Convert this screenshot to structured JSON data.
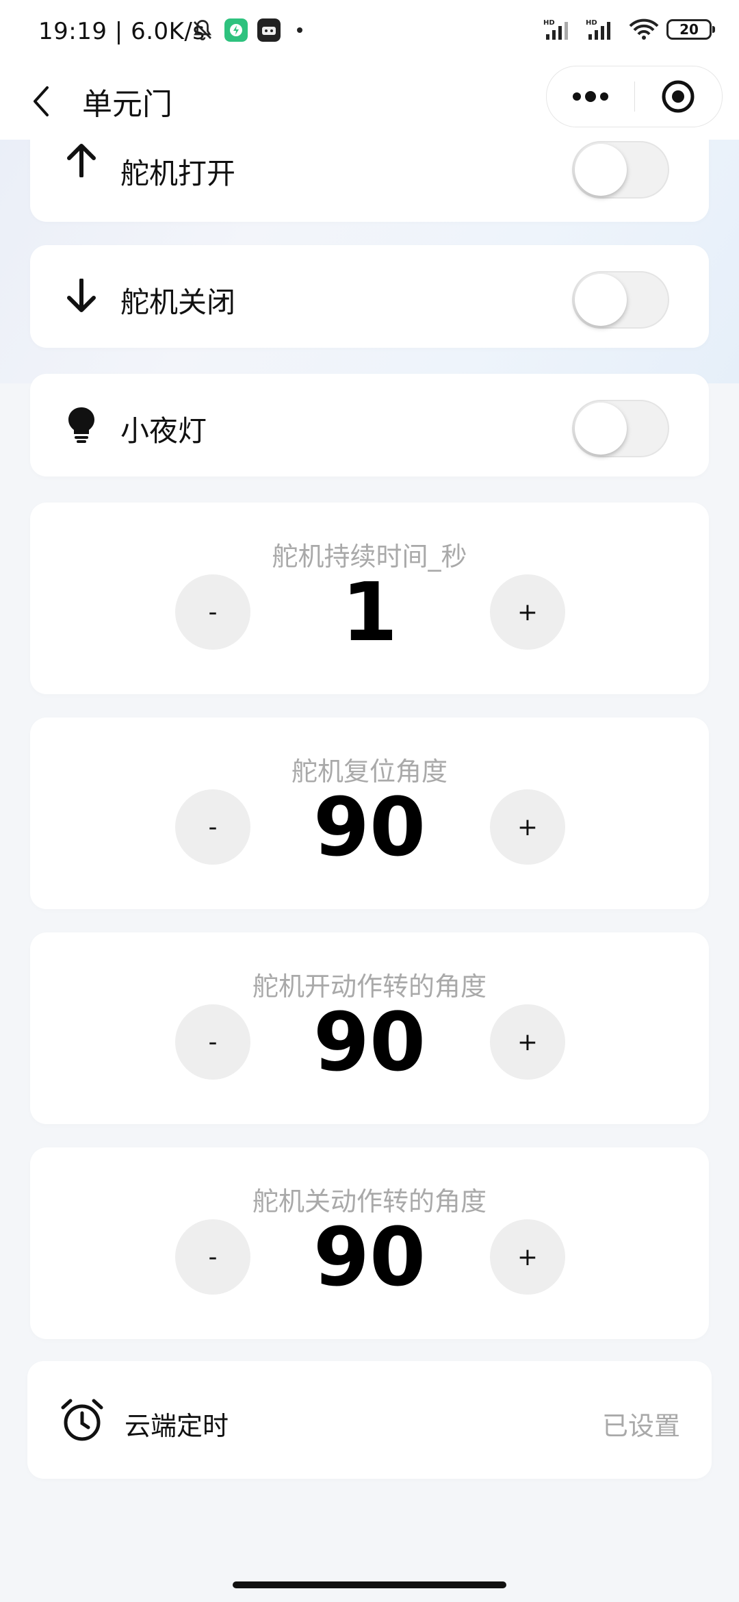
{
  "status_bar": {
    "time": "19:19",
    "network_speed": "6.0K/s",
    "battery": "20",
    "signal_1_label": "HD",
    "signal_2_label": "HD"
  },
  "nav": {
    "title": "单元门"
  },
  "toggles": [
    {
      "label": "舵机打开",
      "icon": "arrow-up-icon",
      "on": false
    },
    {
      "label": "舵机关闭",
      "icon": "arrow-down-icon",
      "on": false
    },
    {
      "label": "小夜灯",
      "icon": "bulb-icon",
      "on": false
    }
  ],
  "steppers": [
    {
      "title": "舵机持续时间_秒",
      "value": "1",
      "minus": "-",
      "plus": "+"
    },
    {
      "title": "舵机复位角度",
      "value": "90",
      "minus": "-",
      "plus": "+"
    },
    {
      "title": "舵机开动作转的角度",
      "value": "90",
      "minus": "-",
      "plus": "+"
    },
    {
      "title": "舵机关动作转的角度",
      "value": "90",
      "minus": "-",
      "plus": "+"
    }
  ],
  "timer": {
    "label": "云端定时",
    "status": "已设置"
  },
  "colors": {
    "accent_app_icon": "#2ec27e",
    "muted_text": "#a9a9a9",
    "switch_off": "#f1f1f1"
  }
}
